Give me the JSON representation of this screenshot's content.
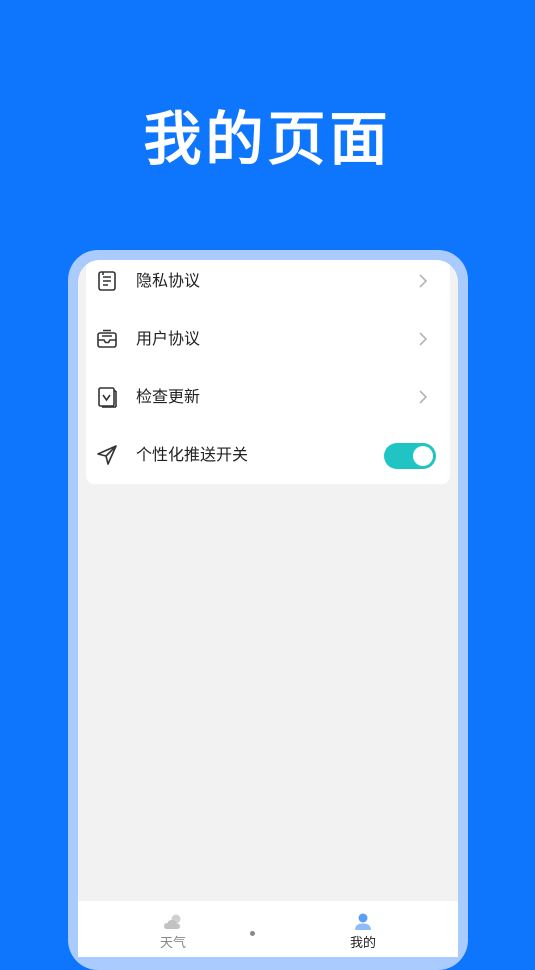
{
  "header": {
    "title": "我的页面"
  },
  "menu": {
    "items": [
      {
        "label": "隐私协议",
        "icon": "privacy-document-icon"
      },
      {
        "label": "用户协议",
        "icon": "mail-inbox-icon"
      },
      {
        "label": "检查更新",
        "icon": "update-check-icon"
      },
      {
        "label": "个性化推送开关",
        "icon": "send-plane-icon"
      }
    ],
    "push_toggle_on": true
  },
  "tabbar": {
    "items": [
      {
        "label": "天气",
        "icon": "weather-cloud-icon",
        "active": false
      },
      {
        "label": "我的",
        "icon": "user-profile-icon",
        "active": true
      }
    ]
  },
  "colors": {
    "background": "#0d76fc",
    "toggle_on": "#20c4c4",
    "tab_active": "#222222",
    "tab_inactive": "#888888"
  }
}
